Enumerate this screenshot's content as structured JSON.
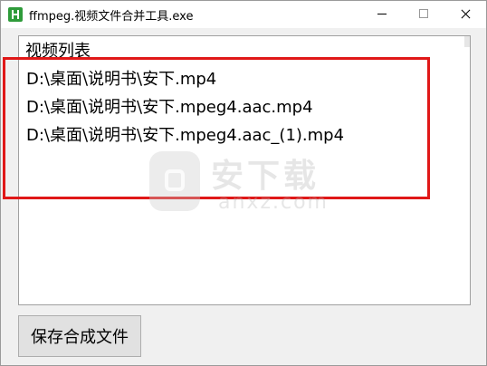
{
  "window": {
    "title": "ffmpeg.视频文件合并工具.exe"
  },
  "list": {
    "header": "视频列表",
    "items": [
      "D:\\桌面\\说明书\\安下.mp4",
      "D:\\桌面\\说明书\\安下.mpeg4.aac.mp4",
      "D:\\桌面\\说明书\\安下.mpeg4.aac_(1).mp4"
    ]
  },
  "watermark": {
    "brand_cn": "安下载",
    "brand_en": "anxz.com"
  },
  "actions": {
    "save_label": "保存合成文件"
  },
  "colors": {
    "highlight_border": "#e01818",
    "app_icon": "#2e9b3a"
  }
}
